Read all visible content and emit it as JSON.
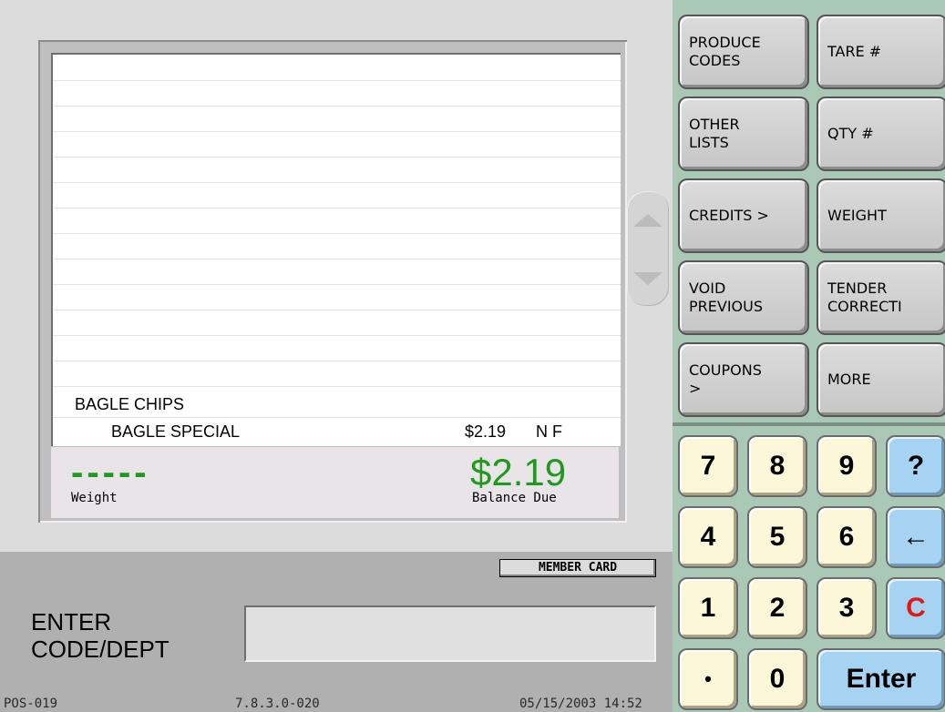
{
  "receipt": {
    "items": [
      {
        "description": "BAGLE CHIPS"
      },
      {
        "description": "BAGLE SPECIAL",
        "price": "$2.19",
        "flags": "N F"
      }
    ]
  },
  "totals": {
    "weight_value": "-----",
    "weight_label": "Weight",
    "balance_amount": "$2.19",
    "balance_label": "Balance Due"
  },
  "member_card_label": "MEMBER CARD",
  "prompt": {
    "line1": "ENTER",
    "line2": "CODE/DEPT"
  },
  "input": {
    "value": "",
    "placeholder": ""
  },
  "status": {
    "terminal": "POS-019",
    "version": "7.8.3.0-020",
    "datetime": "05/15/2003 14:52"
  },
  "function_buttons": [
    {
      "label": "PRODUCE\nCODES"
    },
    {
      "label": "TARE #"
    },
    {
      "label": "OTHER\nLISTS"
    },
    {
      "label": "QTY #"
    },
    {
      "label": "CREDITS >"
    },
    {
      "label": "WEIGHT"
    },
    {
      "label": "VOID\nPREVIOUS"
    },
    {
      "label": "TENDER\nCORRECTI"
    },
    {
      "label": "COUPONS\n>"
    },
    {
      "label": "MORE"
    }
  ],
  "keypad": {
    "k7": "7",
    "k8": "8",
    "k9": "9",
    "help": "?",
    "k4": "4",
    "k5": "5",
    "k6": "6",
    "backspace": "←",
    "k1": "1",
    "k2": "2",
    "k3": "3",
    "clear": "C",
    "dot": "•",
    "k0": "0",
    "enter": "Enter"
  },
  "colors": {
    "total_green": "#1f9a1f",
    "clear_red": "#e01818",
    "keypad_yellow": "#fbf7d8",
    "keypad_blue": "#a6d3f2",
    "right_panel_green": "#a9c8b6"
  },
  "icons": {
    "scroll_up": "triangle-up-icon",
    "scroll_down": "triangle-down-icon",
    "backspace": "left-arrow-icon"
  }
}
